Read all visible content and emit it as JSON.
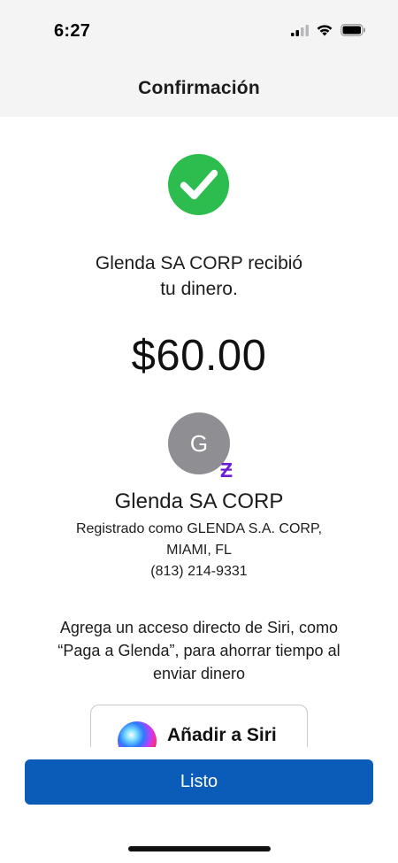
{
  "status_bar": {
    "time": "6:27",
    "signal_icon": "cellular-signal-icon",
    "wifi_icon": "wifi-icon",
    "battery_icon": "battery-icon"
  },
  "header": {
    "title": "Confirmación"
  },
  "confirmation": {
    "icon": "check-circle-icon",
    "accent_color": "#2dbd4e",
    "message_line1": "Glenda SA CORP recibió",
    "message_line2": "tu dinero.",
    "amount": "$60.00"
  },
  "recipient": {
    "avatar_initial": "G",
    "badge_icon": "zelle-icon",
    "badge_glyph": "Ƶ",
    "name": "Glenda SA CORP",
    "registered_line1": "Registrado como GLENDA S.A. CORP,",
    "registered_line2": "MIAMI, FL",
    "phone": "(813) 214-9331"
  },
  "siri": {
    "prompt_line1": "Agrega un acceso directo de Siri, como",
    "prompt_line2": "“Paga a Glenda”, para ahorrar tiempo al",
    "prompt_line3": "enviar dinero",
    "button_label": "Añadir a Siri",
    "button_icon": "siri-icon"
  },
  "footer": {
    "done_label": "Listo",
    "button_color": "#0b5cb8"
  }
}
